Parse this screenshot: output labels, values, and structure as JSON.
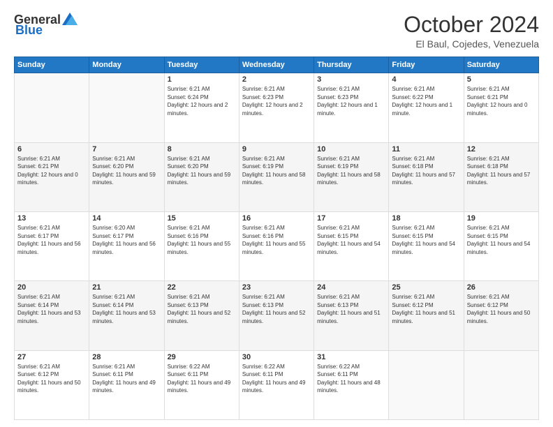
{
  "header": {
    "logo_general": "General",
    "logo_blue": "Blue",
    "month": "October 2024",
    "location": "El Baul, Cojedes, Venezuela"
  },
  "days_of_week": [
    "Sunday",
    "Monday",
    "Tuesday",
    "Wednesday",
    "Thursday",
    "Friday",
    "Saturday"
  ],
  "weeks": [
    [
      {
        "day": "",
        "sunrise": "",
        "sunset": "",
        "daylight": ""
      },
      {
        "day": "",
        "sunrise": "",
        "sunset": "",
        "daylight": ""
      },
      {
        "day": "1",
        "sunrise": "Sunrise: 6:21 AM",
        "sunset": "Sunset: 6:24 PM",
        "daylight": "Daylight: 12 hours and 2 minutes."
      },
      {
        "day": "2",
        "sunrise": "Sunrise: 6:21 AM",
        "sunset": "Sunset: 6:23 PM",
        "daylight": "Daylight: 12 hours and 2 minutes."
      },
      {
        "day": "3",
        "sunrise": "Sunrise: 6:21 AM",
        "sunset": "Sunset: 6:23 PM",
        "daylight": "Daylight: 12 hours and 1 minute."
      },
      {
        "day": "4",
        "sunrise": "Sunrise: 6:21 AM",
        "sunset": "Sunset: 6:22 PM",
        "daylight": "Daylight: 12 hours and 1 minute."
      },
      {
        "day": "5",
        "sunrise": "Sunrise: 6:21 AM",
        "sunset": "Sunset: 6:21 PM",
        "daylight": "Daylight: 12 hours and 0 minutes."
      }
    ],
    [
      {
        "day": "6",
        "sunrise": "Sunrise: 6:21 AM",
        "sunset": "Sunset: 6:21 PM",
        "daylight": "Daylight: 12 hours and 0 minutes."
      },
      {
        "day": "7",
        "sunrise": "Sunrise: 6:21 AM",
        "sunset": "Sunset: 6:20 PM",
        "daylight": "Daylight: 11 hours and 59 minutes."
      },
      {
        "day": "8",
        "sunrise": "Sunrise: 6:21 AM",
        "sunset": "Sunset: 6:20 PM",
        "daylight": "Daylight: 11 hours and 59 minutes."
      },
      {
        "day": "9",
        "sunrise": "Sunrise: 6:21 AM",
        "sunset": "Sunset: 6:19 PM",
        "daylight": "Daylight: 11 hours and 58 minutes."
      },
      {
        "day": "10",
        "sunrise": "Sunrise: 6:21 AM",
        "sunset": "Sunset: 6:19 PM",
        "daylight": "Daylight: 11 hours and 58 minutes."
      },
      {
        "day": "11",
        "sunrise": "Sunrise: 6:21 AM",
        "sunset": "Sunset: 6:18 PM",
        "daylight": "Daylight: 11 hours and 57 minutes."
      },
      {
        "day": "12",
        "sunrise": "Sunrise: 6:21 AM",
        "sunset": "Sunset: 6:18 PM",
        "daylight": "Daylight: 11 hours and 57 minutes."
      }
    ],
    [
      {
        "day": "13",
        "sunrise": "Sunrise: 6:21 AM",
        "sunset": "Sunset: 6:17 PM",
        "daylight": "Daylight: 11 hours and 56 minutes."
      },
      {
        "day": "14",
        "sunrise": "Sunrise: 6:20 AM",
        "sunset": "Sunset: 6:17 PM",
        "daylight": "Daylight: 11 hours and 56 minutes."
      },
      {
        "day": "15",
        "sunrise": "Sunrise: 6:21 AM",
        "sunset": "Sunset: 6:16 PM",
        "daylight": "Daylight: 11 hours and 55 minutes."
      },
      {
        "day": "16",
        "sunrise": "Sunrise: 6:21 AM",
        "sunset": "Sunset: 6:16 PM",
        "daylight": "Daylight: 11 hours and 55 minutes."
      },
      {
        "day": "17",
        "sunrise": "Sunrise: 6:21 AM",
        "sunset": "Sunset: 6:15 PM",
        "daylight": "Daylight: 11 hours and 54 minutes."
      },
      {
        "day": "18",
        "sunrise": "Sunrise: 6:21 AM",
        "sunset": "Sunset: 6:15 PM",
        "daylight": "Daylight: 11 hours and 54 minutes."
      },
      {
        "day": "19",
        "sunrise": "Sunrise: 6:21 AM",
        "sunset": "Sunset: 6:15 PM",
        "daylight": "Daylight: 11 hours and 54 minutes."
      }
    ],
    [
      {
        "day": "20",
        "sunrise": "Sunrise: 6:21 AM",
        "sunset": "Sunset: 6:14 PM",
        "daylight": "Daylight: 11 hours and 53 minutes."
      },
      {
        "day": "21",
        "sunrise": "Sunrise: 6:21 AM",
        "sunset": "Sunset: 6:14 PM",
        "daylight": "Daylight: 11 hours and 53 minutes."
      },
      {
        "day": "22",
        "sunrise": "Sunrise: 6:21 AM",
        "sunset": "Sunset: 6:13 PM",
        "daylight": "Daylight: 11 hours and 52 minutes."
      },
      {
        "day": "23",
        "sunrise": "Sunrise: 6:21 AM",
        "sunset": "Sunset: 6:13 PM",
        "daylight": "Daylight: 11 hours and 52 minutes."
      },
      {
        "day": "24",
        "sunrise": "Sunrise: 6:21 AM",
        "sunset": "Sunset: 6:13 PM",
        "daylight": "Daylight: 11 hours and 51 minutes."
      },
      {
        "day": "25",
        "sunrise": "Sunrise: 6:21 AM",
        "sunset": "Sunset: 6:12 PM",
        "daylight": "Daylight: 11 hours and 51 minutes."
      },
      {
        "day": "26",
        "sunrise": "Sunrise: 6:21 AM",
        "sunset": "Sunset: 6:12 PM",
        "daylight": "Daylight: 11 hours and 50 minutes."
      }
    ],
    [
      {
        "day": "27",
        "sunrise": "Sunrise: 6:21 AM",
        "sunset": "Sunset: 6:12 PM",
        "daylight": "Daylight: 11 hours and 50 minutes."
      },
      {
        "day": "28",
        "sunrise": "Sunrise: 6:21 AM",
        "sunset": "Sunset: 6:11 PM",
        "daylight": "Daylight: 11 hours and 49 minutes."
      },
      {
        "day": "29",
        "sunrise": "Sunrise: 6:22 AM",
        "sunset": "Sunset: 6:11 PM",
        "daylight": "Daylight: 11 hours and 49 minutes."
      },
      {
        "day": "30",
        "sunrise": "Sunrise: 6:22 AM",
        "sunset": "Sunset: 6:11 PM",
        "daylight": "Daylight: 11 hours and 49 minutes."
      },
      {
        "day": "31",
        "sunrise": "Sunrise: 6:22 AM",
        "sunset": "Sunset: 6:11 PM",
        "daylight": "Daylight: 11 hours and 48 minutes."
      },
      {
        "day": "",
        "sunrise": "",
        "sunset": "",
        "daylight": ""
      },
      {
        "day": "",
        "sunrise": "",
        "sunset": "",
        "daylight": ""
      }
    ]
  ]
}
